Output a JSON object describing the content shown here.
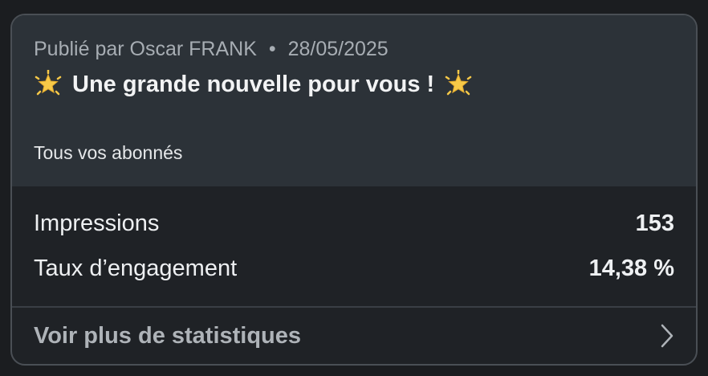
{
  "post": {
    "published_prefix": "Publié par",
    "author": "Oscar FRANK",
    "separator": "•",
    "date": "28/05/2025",
    "title": "Une grande nouvelle pour vous !",
    "title_icon": "glowing-star-icon",
    "audience": "Tous vos abonnés"
  },
  "stats": {
    "impressions_label": "Impressions",
    "impressions_value": "153",
    "engagement_label": "Taux d’engagement",
    "engagement_value": "14,38 %"
  },
  "footer": {
    "more_label": "Voir plus de statistiques",
    "chevron_icon": "chevron-right-icon"
  },
  "colors": {
    "page_bg": "#1b1d20",
    "header_bg": "#2c3238",
    "card_bg": "#1f2226",
    "border": "#4a4f55",
    "star": "#f7c948"
  }
}
